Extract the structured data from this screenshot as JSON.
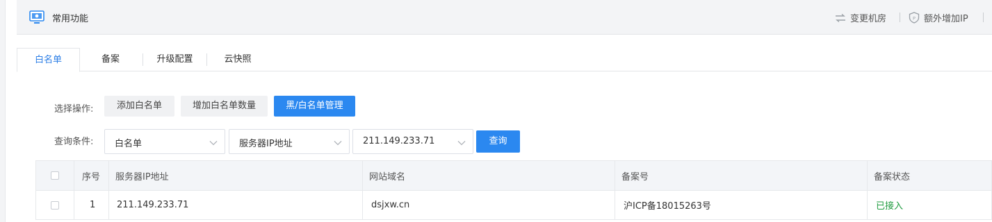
{
  "header": {
    "title": "常用功能",
    "actions": [
      {
        "label": "变更机房",
        "icon": "swap-icon"
      },
      {
        "label": "额外增加IP",
        "icon": "ip-shield-icon"
      }
    ]
  },
  "tabs": [
    {
      "label": "白名单",
      "active": true
    },
    {
      "label": "备案",
      "active": false
    },
    {
      "label": "升级配置",
      "active": false
    },
    {
      "label": "云快照",
      "active": false
    }
  ],
  "operations": {
    "label": "选择操作:",
    "buttons": [
      "添加白名单",
      "增加白名单数量",
      "黑/白名单管理"
    ],
    "active_index": 2
  },
  "query": {
    "label": "查询条件:",
    "list_type": "白名单",
    "field": "服务器IP地址",
    "ip_value": "211.149.233.71",
    "submit_label": "查询"
  },
  "table": {
    "headers": [
      "序号",
      "服务器IP地址",
      "网站域名",
      "备案号",
      "备案状态"
    ],
    "rows": [
      {
        "index": "1",
        "ip": "211.149.233.71",
        "domain": "dsjxw.cn",
        "icp": "沪ICP备18015263号",
        "status": "已接入"
      }
    ]
  },
  "colors": {
    "accent": "#2b88f0",
    "active_tab": "#2b7ee6",
    "status_ok": "#1e9b3e"
  }
}
